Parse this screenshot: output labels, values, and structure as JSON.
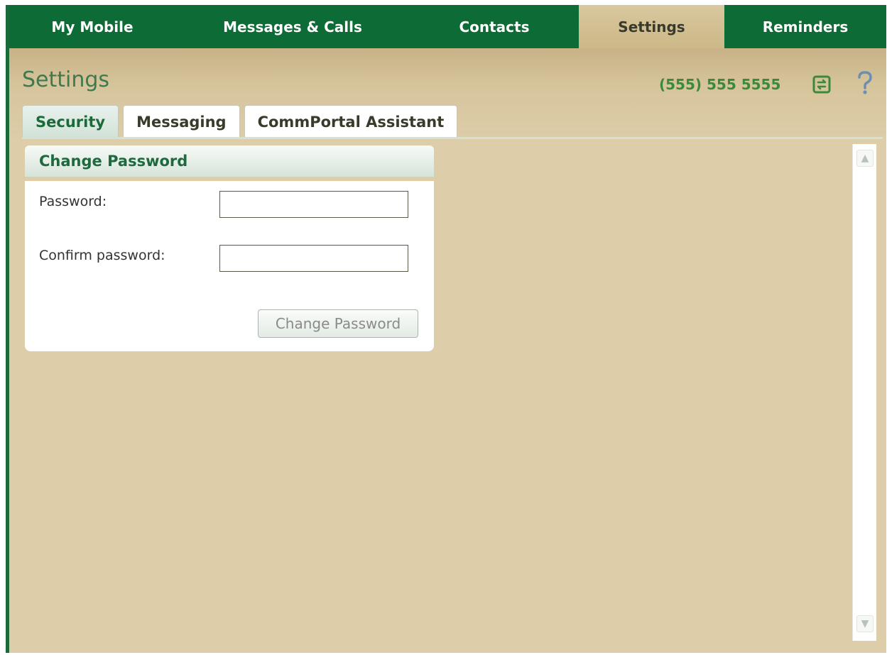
{
  "topnav": {
    "items": [
      {
        "label": "My Mobile",
        "active": false
      },
      {
        "label": "Messages & Calls",
        "active": false
      },
      {
        "label": "Contacts",
        "active": false
      },
      {
        "label": "Settings",
        "active": true
      },
      {
        "label": "Reminders",
        "active": false
      }
    ]
  },
  "header": {
    "title": "Settings",
    "phone_number": "(555) 555 5555",
    "icons": [
      "refresh-icon",
      "help-icon"
    ]
  },
  "tabs": [
    {
      "label": "Security",
      "active": true
    },
    {
      "label": "Messaging",
      "active": false
    },
    {
      "label": "CommPortal Assistant",
      "active": false
    }
  ],
  "panel": {
    "title": "Change Password",
    "fields": [
      {
        "label": "Password:",
        "value": "",
        "placeholder": ""
      },
      {
        "label": "Confirm password:",
        "value": "",
        "placeholder": ""
      }
    ],
    "submit_label": "Change Password"
  },
  "scrollbar": {
    "up_icon": "chevron-up-icon",
    "down_icon": "chevron-down-icon"
  },
  "colors": {
    "brand_green": "#0d6b35",
    "background_tan": "#ddcda8",
    "phone_green": "#3b8a3c"
  }
}
